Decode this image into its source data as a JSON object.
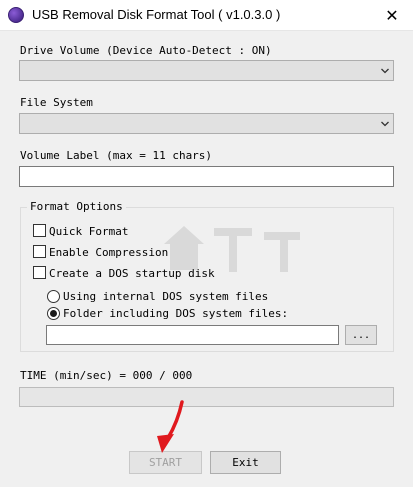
{
  "window": {
    "title": "USB Removal Disk Format Tool ( v1.0.3.0 )",
    "close_glyph": "✕"
  },
  "drive_volume": {
    "label": "Drive Volume  (Device Auto-Detect : ON)",
    "selected": ""
  },
  "file_system": {
    "label": "File System",
    "selected": ""
  },
  "volume_label": {
    "label": "Volume Label (max = 11 chars)",
    "value": ""
  },
  "format_options": {
    "title": "Format Options",
    "quick_format": {
      "label": "Quick Format",
      "checked": false
    },
    "enable_compression": {
      "label": "Enable Compression",
      "checked": false
    },
    "create_dos_startup": {
      "label": "Create a DOS startup disk",
      "checked": false
    },
    "radio_internal": {
      "label": "Using internal DOS system files",
      "checked": false
    },
    "radio_folder": {
      "label": "Folder including DOS system files:",
      "checked": true
    },
    "folder_path": "",
    "browse_label": "..."
  },
  "time": {
    "label": "TIME (min/sec) = 000 / 000",
    "progress": 0
  },
  "buttons": {
    "start_label": "START",
    "exit_label": "Exit"
  },
  "colors": {
    "window_bg": "#f0f0f0",
    "annotation_arrow": "#e0191e",
    "watermark": "#8a8a8a"
  },
  "icons": {
    "app": "app-disk-icon",
    "dropdown": "chevron-down-icon",
    "close": "close-icon"
  }
}
